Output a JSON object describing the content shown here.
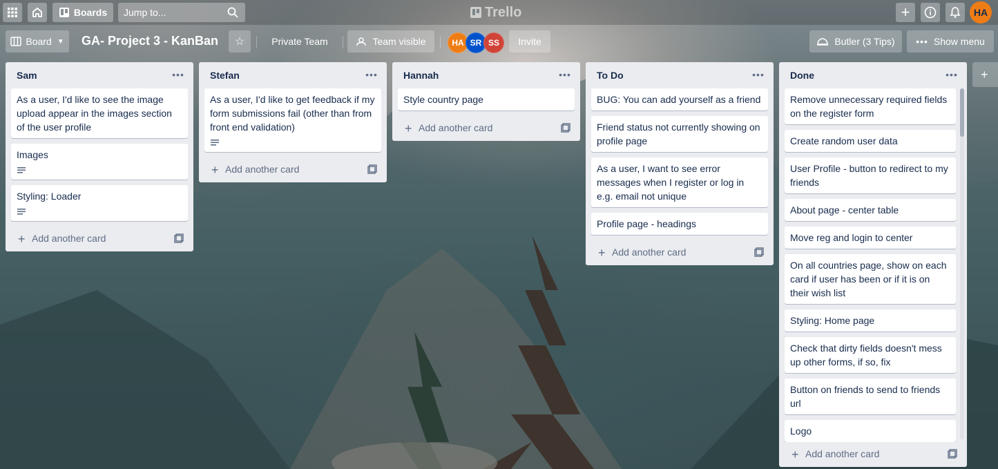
{
  "topbar": {
    "boards_label": "Boards",
    "search_placeholder": "Jump to...",
    "logo_text": "Trello",
    "user_initials": "HA"
  },
  "board_header": {
    "view_label": "Board",
    "title": "GA- Project 3 - KanBan",
    "team_label": "Private Team",
    "visibility_label": "Team visible",
    "members": [
      {
        "initials": "HA",
        "color": "#ef7d15"
      },
      {
        "initials": "SR",
        "color": "#0052cc"
      },
      {
        "initials": "SS",
        "color": "#d04437"
      }
    ],
    "invite_label": "Invite",
    "butler_label": "Butler (3 Tips)",
    "show_menu_label": "Show menu"
  },
  "lists": [
    {
      "title": "Sam",
      "cards": [
        {
          "text": "As a user, I'd like to see the image upload appear in the images section of the user profile",
          "has_description": false
        },
        {
          "text": "Images",
          "has_description": true
        },
        {
          "text": "Styling: Loader",
          "has_description": true
        }
      ],
      "add_label": "Add another card"
    },
    {
      "title": "Stefan",
      "cards": [
        {
          "text": "As a user, I'd like to get feedback if my form submissions fail (other than from front end validation)",
          "has_description": true
        }
      ],
      "add_label": "Add another card"
    },
    {
      "title": "Hannah",
      "cards": [
        {
          "text": "Style country page",
          "has_description": false
        }
      ],
      "add_label": "Add another card"
    },
    {
      "title": "To Do",
      "cards": [
        {
          "text": "BUG: You can add yourself as a friend",
          "has_description": false
        },
        {
          "text": "Friend status not currently showing on profile page",
          "has_description": false
        },
        {
          "text": "As a user, I want to see error messages when I register or log in e.g. email not unique",
          "has_description": false
        },
        {
          "text": "Profile page - headings",
          "has_description": false
        }
      ],
      "add_label": "Add another card"
    },
    {
      "title": "Done",
      "cards": [
        {
          "text": "Remove unnecessary required fields on the register form",
          "has_description": false
        },
        {
          "text": "Create random user data",
          "has_description": false
        },
        {
          "text": "User Profile - button to redirect to my friends",
          "has_description": false
        },
        {
          "text": "About page - center table",
          "has_description": false
        },
        {
          "text": "Move reg and login to center",
          "has_description": false
        },
        {
          "text": "On all countries page, show on each card if user has been or if it is on their wish list",
          "has_description": false
        },
        {
          "text": "Styling: Home page",
          "has_description": false
        },
        {
          "text": "Check that dirty fields doesn't mess up other forms, if so, fix",
          "has_description": false
        },
        {
          "text": "Button on friends to send to friends url",
          "has_description": false
        },
        {
          "text": "Logo",
          "has_description": false
        }
      ],
      "add_label": "Add another card"
    }
  ],
  "colors": {
    "list_bg": "#ebecf0",
    "card_bg": "#ffffff",
    "text": "#172b4d",
    "muted": "#5e6c84"
  }
}
